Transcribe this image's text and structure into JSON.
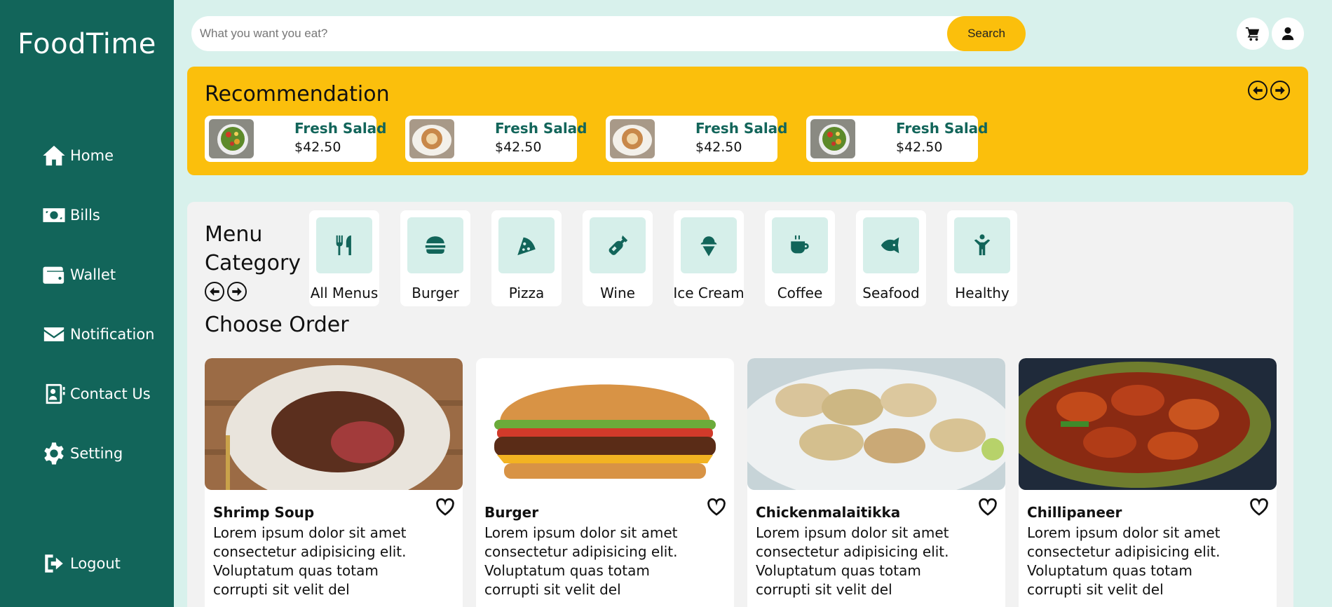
{
  "brand": "FoodTime",
  "sidebar": {
    "items": [
      {
        "label": "Home",
        "icon": "home-icon"
      },
      {
        "label": "Bills",
        "icon": "money-bill-icon"
      },
      {
        "label": "Wallet",
        "icon": "wallet-icon"
      },
      {
        "label": "Notification",
        "icon": "envelope-icon"
      },
      {
        "label": "Contact Us",
        "icon": "contact-card-icon"
      },
      {
        "label": "Setting",
        "icon": "gear-icon"
      }
    ],
    "logout": {
      "label": "Logout",
      "icon": "logout-icon"
    }
  },
  "search": {
    "placeholder": "What you want you eat?",
    "button_label": "Search"
  },
  "header": {
    "cart_icon": "cart-icon",
    "user_icon": "user-icon"
  },
  "recommendation": {
    "title": "Recommendation",
    "items": [
      {
        "name": "Fresh Salad",
        "price": "$42.50",
        "image": "salad-image"
      },
      {
        "name": "Fresh Salad",
        "price": "$42.50",
        "image": "coffee-image"
      },
      {
        "name": "Fresh Salad",
        "price": "$42.50",
        "image": "coffee-image"
      },
      {
        "name": "Fresh Salad",
        "price": "$42.50",
        "image": "salad-image"
      }
    ]
  },
  "menu_category": {
    "title": "Menu Category",
    "items": [
      {
        "label": "All Menus",
        "icon": "utensils-icon"
      },
      {
        "label": "Burger",
        "icon": "burger-icon"
      },
      {
        "label": "Pizza",
        "icon": "pizza-icon"
      },
      {
        "label": "Wine",
        "icon": "wine-bottle-icon"
      },
      {
        "label": "Ice Cream",
        "icon": "ice-cream-icon"
      },
      {
        "label": "Coffee",
        "icon": "coffee-icon"
      },
      {
        "label": "Seafood",
        "icon": "fish-icon"
      },
      {
        "label": "Healthy",
        "icon": "person-icon"
      }
    ]
  },
  "choose_order": {
    "title": "Choose Order",
    "items": [
      {
        "name": "Shrimp Soup",
        "description": "Lorem ipsum dolor sit amet consectetur adipisicing elit. Voluptatum quas totam corrupti sit velit del",
        "image": "steak-image"
      },
      {
        "name": "Burger",
        "description": "Lorem ipsum dolor sit amet consectetur adipisicing elit. Voluptatum quas totam corrupti sit velit del",
        "image": "burger-image"
      },
      {
        "name": "Chickenmalaitikka",
        "description": "Lorem ipsum dolor sit amet consectetur adipisicing elit. Voluptatum quas totam corrupti sit velit del",
        "image": "chicken-tikka-image"
      },
      {
        "name": "Chillipaneer",
        "description": "Lorem ipsum dolor sit amet consectetur adipisicing elit. Voluptatum quas totam corrupti sit velit del",
        "image": "chilli-paneer-image"
      }
    ]
  },
  "colors": {
    "sidebar": "#12655a",
    "accent": "#fbbf0c",
    "background": "#d8f1ec",
    "panel": "#f2f2f2"
  }
}
